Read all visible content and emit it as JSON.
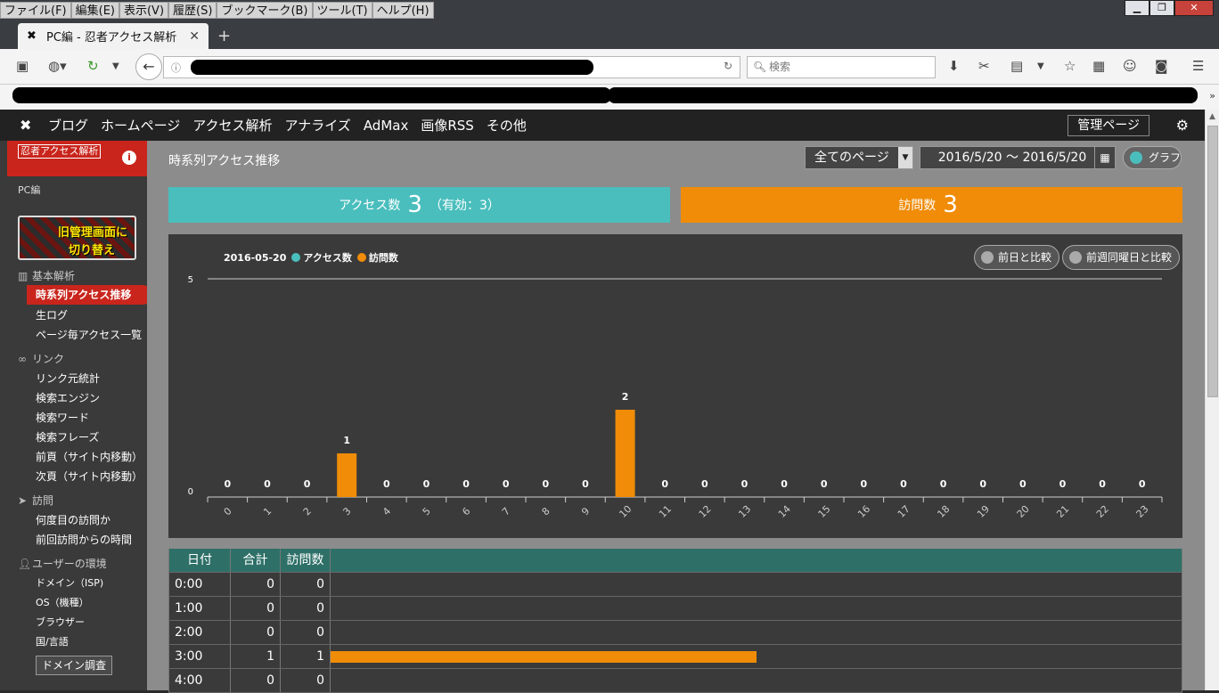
{
  "browser": {
    "menu": [
      "ファイル(F)",
      "編集(E)",
      "表示(V)",
      "履歴(S)",
      "ブックマーク(B)",
      "ツール(T)",
      "ヘルプ(H)"
    ],
    "tab_title": "PC編 - 忍者アクセス解析",
    "search_placeholder": "検索"
  },
  "site": {
    "nav": [
      "ブログ",
      "ホームページ",
      "アクセス解析",
      "アナライズ",
      "AdMax",
      "画像RSS",
      "その他"
    ],
    "admin_label": "管理ページ"
  },
  "sidebar": {
    "logo_text": "忍者アクセス解析",
    "section": "PC編",
    "banner_line1": "旧管理画面に",
    "banner_line2": "切り替え",
    "categories": [
      {
        "label": "基本解析",
        "items": [
          "時系列アクセス推移",
          "生ログ",
          "ページ毎アクセス一覧"
        ]
      },
      {
        "label": "リンク",
        "items": [
          "リンク元統計",
          "検索エンジン",
          "検索ワード",
          "検索フレーズ",
          "前頁（サイト内移動）",
          "次頁（サイト内移動）"
        ]
      },
      {
        "label": "訪問",
        "items": [
          "何度目の訪問か",
          "前回訪問からの時間"
        ]
      },
      {
        "label": "ユーザーの環境",
        "items": [
          "ドメイン（ISP)",
          "OS（機種）",
          "ブラウザー",
          "国/言語"
        ]
      }
    ],
    "domain_button": "ドメイン調査"
  },
  "main": {
    "title": "時系列アクセス推移",
    "page_select": "全てのページ",
    "date_range": "2016/5/20 〜 2016/5/20",
    "graph_toggle": "グラフ",
    "access_label": "アクセス数",
    "access_value": "3",
    "access_valid": "（有効：3）",
    "visit_label": "訪問数",
    "visit_value": "3",
    "compare_prev_day": "前日と比較",
    "compare_prev_week": "前週同曜日と比較"
  },
  "chart_data": {
    "type": "bar",
    "legend_date": "2016-05-20",
    "categories": [
      "0",
      "1",
      "2",
      "3",
      "4",
      "5",
      "6",
      "7",
      "8",
      "9",
      "10",
      "11",
      "12",
      "13",
      "14",
      "15",
      "16",
      "17",
      "18",
      "19",
      "20",
      "21",
      "22",
      "23"
    ],
    "series": [
      {
        "name": "アクセス数",
        "color": "#4abebd",
        "values": [
          0,
          0,
          0,
          1,
          0,
          0,
          0,
          0,
          0,
          0,
          2,
          0,
          0,
          0,
          0,
          0,
          0,
          0,
          0,
          0,
          0,
          0,
          0,
          0
        ]
      },
      {
        "name": "訪問数",
        "color": "#f08c08",
        "values": [
          0,
          0,
          0,
          1,
          0,
          0,
          0,
          0,
          0,
          0,
          2,
          0,
          0,
          0,
          0,
          0,
          0,
          0,
          0,
          0,
          0,
          0,
          0,
          0
        ]
      }
    ],
    "ylim": [
      0,
      5
    ],
    "yticks": [
      "5",
      "0"
    ]
  },
  "table": {
    "headers": [
      "日付",
      "合計",
      "訪問数"
    ],
    "rows": [
      {
        "time": "0:00",
        "total": "0",
        "visits": "0",
        "bar": 0
      },
      {
        "time": "1:00",
        "total": "0",
        "visits": "0",
        "bar": 0
      },
      {
        "time": "2:00",
        "total": "0",
        "visits": "0",
        "bar": 0
      },
      {
        "time": "3:00",
        "total": "1",
        "visits": "1",
        "bar": 0.5
      },
      {
        "time": "4:00",
        "total": "0",
        "visits": "0",
        "bar": 0
      }
    ]
  }
}
